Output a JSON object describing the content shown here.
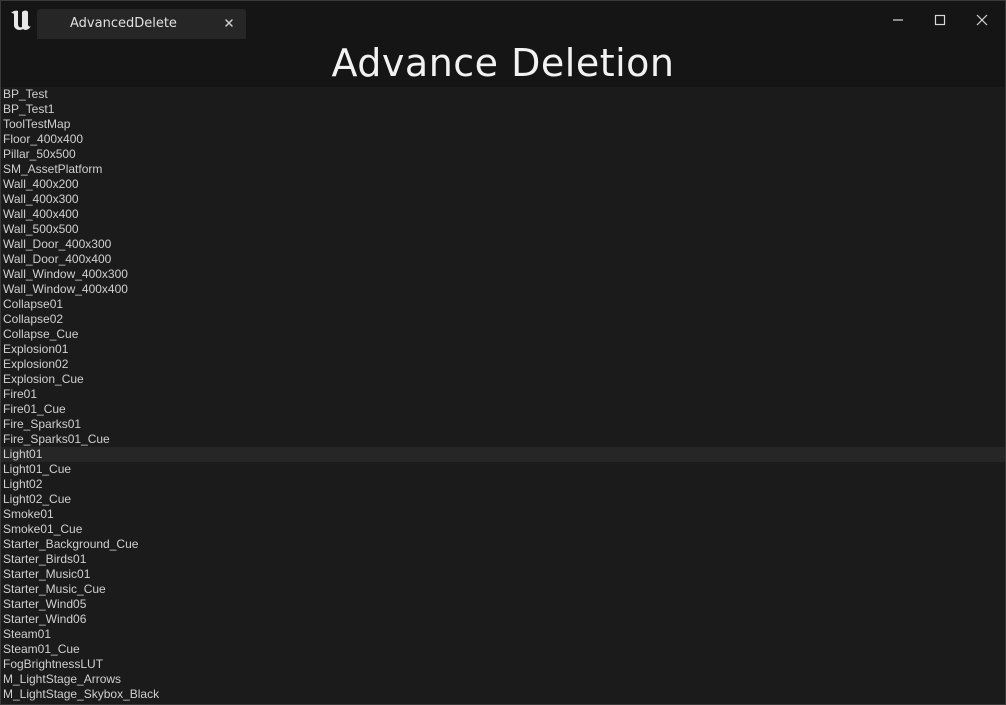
{
  "window": {
    "tab_title": "AdvancedDelete",
    "icons": {
      "logo": "unreal-logo-icon",
      "tab_close": "close-icon",
      "minimize": "minimize-icon",
      "maximize": "maximize-icon",
      "close": "close-icon"
    }
  },
  "header": {
    "title": "Advance Deletion"
  },
  "assets": [
    "BP_Test",
    "BP_Test1",
    "ToolTestMap",
    "Floor_400x400",
    "Pillar_50x500",
    "SM_AssetPlatform",
    "Wall_400x200",
    "Wall_400x300",
    "Wall_400x400",
    "Wall_500x500",
    "Wall_Door_400x300",
    "Wall_Door_400x400",
    "Wall_Window_400x300",
    "Wall_Window_400x400",
    "Collapse01",
    "Collapse02",
    "Collapse_Cue",
    "Explosion01",
    "Explosion02",
    "Explosion_Cue",
    "Fire01",
    "Fire01_Cue",
    "Fire_Sparks01",
    "Fire_Sparks01_Cue",
    "Light01",
    "Light01_Cue",
    "Light02",
    "Light02_Cue",
    "Smoke01",
    "Smoke01_Cue",
    "Starter_Background_Cue",
    "Starter_Birds01",
    "Starter_Music01",
    "Starter_Music_Cue",
    "Starter_Wind05",
    "Starter_Wind06",
    "Steam01",
    "Steam01_Cue",
    "FogBrightnessLUT",
    "M_LightStage_Arrows",
    "M_LightStage_Skybox_Black"
  ],
  "hovered_index": 24,
  "colors": {
    "background": "#1b1b1b",
    "titlebar": "#151515",
    "text": "#d0d0d0",
    "title_text": "#f2f2f2",
    "hover_row": "#262626"
  }
}
